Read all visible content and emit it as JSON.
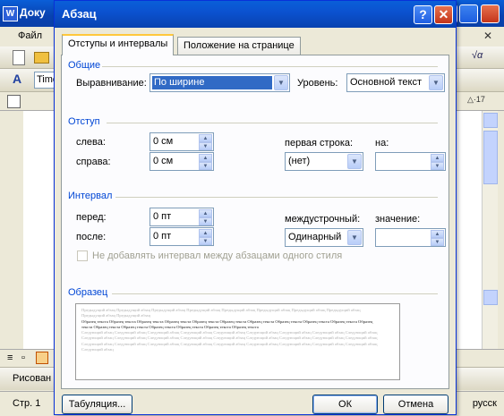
{
  "background_app": {
    "title": "Доку",
    "menu": "Файл",
    "font": "Time",
    "drawing": "Рисован",
    "status_page": "Стр. 1",
    "status_lang": "русск"
  },
  "dialog": {
    "title": "Абзац",
    "help_label": "?",
    "close_label": "✕",
    "tabs": [
      "Отступы и интервалы",
      "Положение на странице"
    ],
    "general": {
      "heading": "Общие",
      "alignment_label": "Выравнивание:",
      "alignment_value": "По ширине",
      "level_label": "Уровень:",
      "level_value": "Основной текст"
    },
    "indent": {
      "heading": "Отступ",
      "left_label": "слева:",
      "left_value": "0 см",
      "right_label": "справа:",
      "right_value": "0 см",
      "first_line_label": "первая строка:",
      "first_line_value": "(нет)",
      "by_label": "на:",
      "by_value": ""
    },
    "spacing": {
      "heading": "Интервал",
      "before_label": "перед:",
      "before_value": "0 пт",
      "after_label": "после:",
      "after_value": "0 пт",
      "line_label": "междустрочный:",
      "line_value": "Одинарный",
      "at_label": "значение:",
      "at_value": "",
      "no_space_label": "Не добавлять интервал между абзацами одного стиля"
    },
    "preview": {
      "heading": "Образец",
      "prev_text": "Предыдущий абзац Предыдущий абзац Предыдущий абзац Предыдущий абзац Предыдущий абзац Предыдущий абзац Предыдущий абзац Предыдущий абзац Предыдущий абзац Предыдущий абзац",
      "sample_text": "Образец текста Образец текста Образец текста Образец текста Образец текста Образец текста Образец текста Образец текста Образец текста Образец текста Образец текста Образец текста Образец текста Образец текста Образец текста Образец текста Образец текста",
      "next_text": "Следующий абзац Следующий абзац Следующий абзац Следующий абзац Следующий абзац Следующий абзац Следующий абзац Следующий абзац Следующий абзац Следующий абзац Следующий абзац Следующий абзац Следующий абзац Следующий абзац Следующий абзац Следующий абзац Следующий абзац Следующий абзац Следующий абзац Следующий абзац Следующий абзац Следующий абзац Следующий абзац Следующий абзац Следующий абзац Следующий абзац Следующий абзац Следующий абзац"
    },
    "buttons": {
      "tabs": "Табуляция...",
      "ok": "ОК",
      "cancel": "Отмена"
    }
  },
  "colors": {
    "title_bar": "#0a5fd8",
    "group_heading": "#0046d5",
    "selection": "#316ac5"
  }
}
